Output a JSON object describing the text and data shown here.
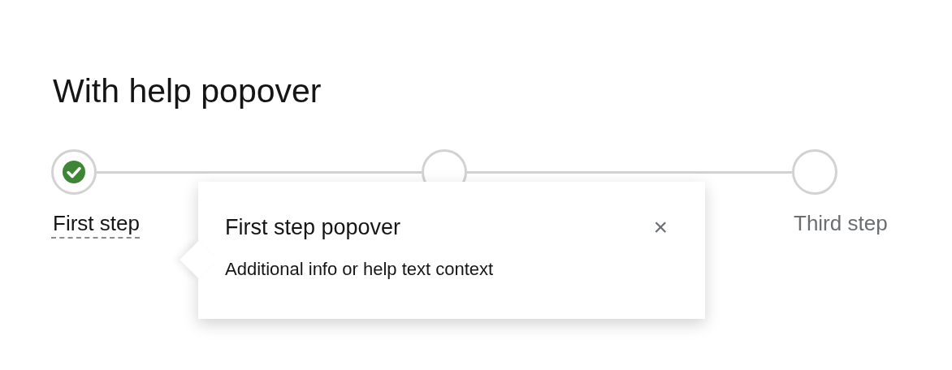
{
  "heading": "With help popover",
  "steps": [
    {
      "label": "First step",
      "complete": true,
      "help": true
    },
    {
      "complete": false
    },
    {
      "label": "Third step",
      "complete": false,
      "help": false
    }
  ],
  "popover": {
    "title": "First step popover",
    "body": "Additional info or help text context",
    "close": "×"
  }
}
